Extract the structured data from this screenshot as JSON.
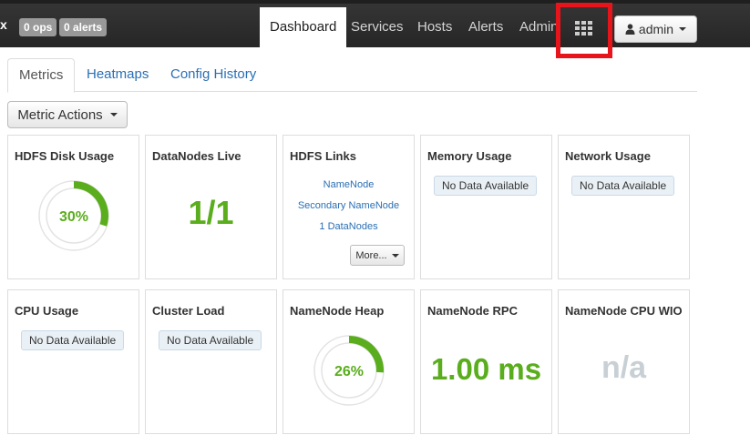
{
  "topbar": {
    "brand": "x",
    "ops_badge": "0 ops",
    "alerts_badge": "0 alerts",
    "nav": [
      "Dashboard",
      "Services",
      "Hosts",
      "Alerts",
      "Admin"
    ],
    "apps_icon": "grid-icon",
    "user_label": "admin",
    "user_icon": "user-icon"
  },
  "tabs": [
    "Metrics",
    "Heatmaps",
    "Config History"
  ],
  "metric_actions_label": "Metric Actions",
  "widgets": {
    "hdfs_disk_usage": {
      "title": "HDFS Disk Usage",
      "percent": "30%",
      "fraction": 0.3
    },
    "datanodes_live": {
      "title": "DataNodes Live",
      "value": "1/1"
    },
    "hdfs_links": {
      "title": "HDFS Links",
      "links": [
        "NameNode",
        "Secondary NameNode",
        "1 DataNodes"
      ],
      "more_label": "More..."
    },
    "memory_usage": {
      "title": "Memory Usage",
      "status": "No Data Available"
    },
    "network_usage": {
      "title": "Network Usage",
      "status": "No Data Available"
    },
    "cpu_usage": {
      "title": "CPU Usage",
      "status": "No Data Available"
    },
    "cluster_load": {
      "title": "Cluster Load",
      "status": "No Data Available"
    },
    "namenode_heap": {
      "title": "NameNode Heap",
      "percent": "26%",
      "fraction": 0.26
    },
    "namenode_rpc": {
      "title": "NameNode RPC",
      "value": "1.00 ms"
    },
    "namenode_cpu_wio": {
      "title": "NameNode CPU WIO",
      "value": "n/a"
    }
  },
  "colors": {
    "accent_green": "#5aad1c",
    "highlight_red": "#e8141c",
    "link_blue": "#2a6fb5"
  }
}
